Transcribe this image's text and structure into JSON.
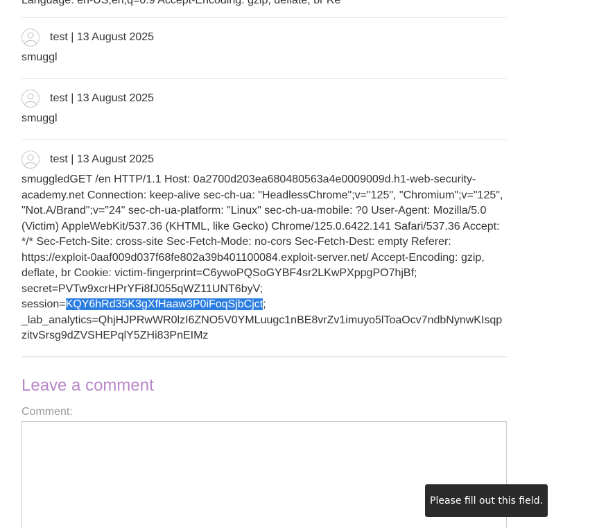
{
  "previous_comment_tail": "Language: en-US,en;q=0.9 Accept-Encoding: gzip, deflate, br Re",
  "comments": [
    {
      "author_date": "test | 13 August 2025",
      "body": "smuggl"
    },
    {
      "author_date": "test | 13 August 2025",
      "body": "smuggl"
    },
    {
      "author_date": "test | 13 August 2025",
      "body_before": "smuggledGET /en HTTP/1.1 Host: 0a2700d203ea680480563a4e0009009d.h1-web-security-academy.net Connection: keep-alive sec-ch-ua: \"HeadlessChrome\";v=\"125\", \"Chromium\";v=\"125\", \"Not.A/Brand\";v=\"24\" sec-ch-ua-platform: \"Linux\" sec-ch-ua-mobile: ?0 User-Agent: Mozilla/5.0 (Victim) AppleWebKit/537.36 (KHTML, like Gecko) Chrome/125.0.6422.141 Safari/537.36 Accept: */* Sec-Fetch-Site: cross-site Sec-Fetch-Mode: no-cors Sec-Fetch-Dest: empty Referer: https://exploit-0aaf009d037f68fe802a39b401100084.exploit-server.net/ Accept-Encoding: gzip, deflate, br Cookie: victim-fingerprint=C6ywoPQSoGYBF4sr2LKwPXppgPO7hjBf; secret=PVTw9xcrHPrYFi8fJ055qWZ11UNT6byV; session=",
      "body_selected": "KQY6hRd35K3gXfHaaw3P0iFoqSjbCjct",
      "body_after": "; _lab_analytics=QhjHJPRwWR0lzI6ZNO5V0YMLuugc1nBE8vrZv1imuyo5lToaOcv7ndbNynwKIsqpzitvSrsg9dZVSHEPqlY5ZHi83PnEIMz"
    }
  ],
  "leave_comment": {
    "title": "Leave a comment",
    "comment_label": "Comment:",
    "comment_value": ""
  },
  "validation_tooltip": "Please fill out this field.",
  "colors": {
    "title_accent": "#b887c9",
    "selection": "#2a7de1"
  },
  "icons": {
    "avatar": "user-avatar-icon"
  }
}
